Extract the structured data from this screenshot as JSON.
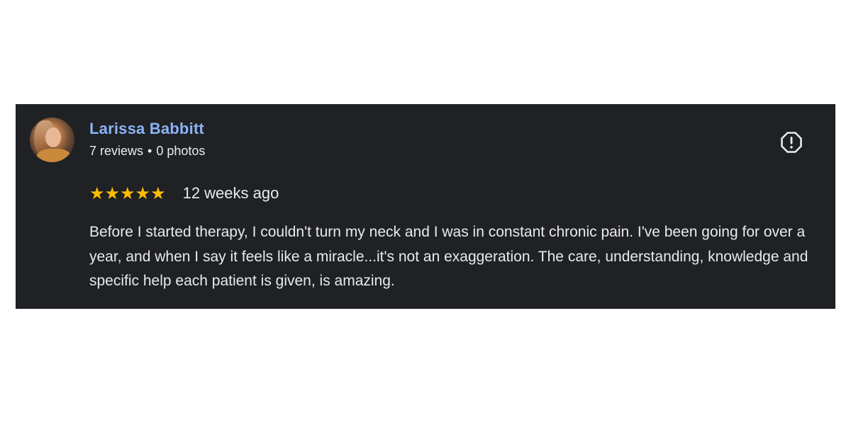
{
  "review": {
    "author": {
      "name": "Larissa Babbitt",
      "reviews_count": "7 reviews",
      "separator": "•",
      "photos_count": "0 photos",
      "avatar_icon": "user-avatar-photo"
    },
    "rating": {
      "stars": 5,
      "max_stars": 5,
      "stars_text": "★★★★★",
      "color": "#fbbc04"
    },
    "date": "12 weeks ago",
    "text": "Before I started therapy, I couldn't turn my neck and I was in constant chronic pain. I've been going for over a year, and when I say it feels like a miracle...it's not an exaggeration. The care, understanding, knowledge and specific help each patient is given, is amazing.",
    "flag_icon": "report-flag-icon"
  },
  "colors": {
    "card_background": "#202124",
    "name": "#8ab4f8",
    "text": "#e8eaed",
    "page_background": "#ffffff"
  }
}
